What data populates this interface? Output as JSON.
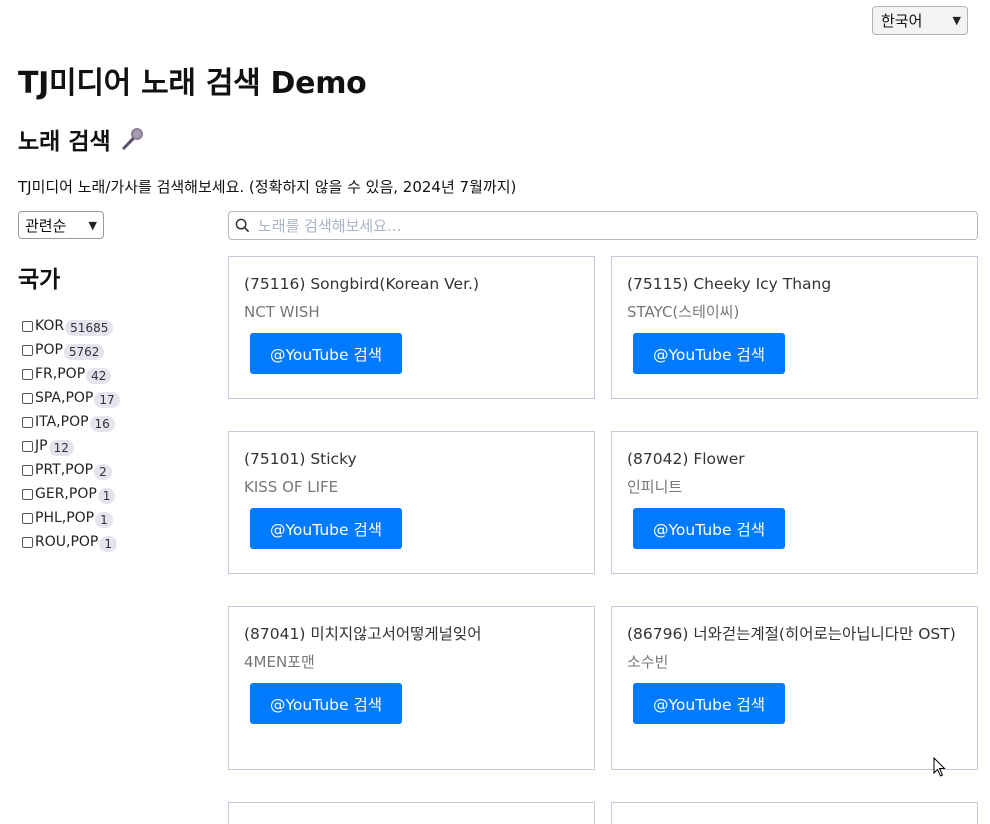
{
  "language_select": {
    "value": "한국어"
  },
  "page_title": "TJ미디어 노래 검색 Demo",
  "section_title": "노래 검색",
  "description": "TJ미디어 노래/가사를 검색해보세요. (정확하지 않을 수 있음, 2024년 7월까지)",
  "sort_select": {
    "value": "관련순"
  },
  "search": {
    "placeholder": "노래를 검색해보세요..."
  },
  "filter": {
    "title": "국가",
    "items": [
      {
        "label": "KOR",
        "count": "51685"
      },
      {
        "label": "POP",
        "count": "5762"
      },
      {
        "label": "FR,POP",
        "count": "42"
      },
      {
        "label": "SPA,POP",
        "count": "17"
      },
      {
        "label": "ITA,POP",
        "count": "16"
      },
      {
        "label": "JP",
        "count": "12"
      },
      {
        "label": "PRT,POP",
        "count": "2"
      },
      {
        "label": "GER,POP",
        "count": "1"
      },
      {
        "label": "PHL,POP",
        "count": "1"
      },
      {
        "label": "ROU,POP",
        "count": "1"
      }
    ]
  },
  "results": [
    {
      "title": "(75116) Songbird(Korean Ver.)",
      "artist": "NCT WISH",
      "button": "@YouTube 검색"
    },
    {
      "title": "(75115) Cheeky Icy Thang",
      "artist": "STAYC(스테이씨)",
      "button": "@YouTube 검색"
    },
    {
      "title": "(75101) Sticky",
      "artist": "KISS OF LIFE",
      "button": "@YouTube 검색"
    },
    {
      "title": "(87042) Flower",
      "artist": "인피니트",
      "button": "@YouTube 검색"
    },
    {
      "title": "(87041) 미치지않고서어떻게널잊어",
      "artist": "4MEN포맨",
      "button": "@YouTube 검색"
    },
    {
      "title": "(86796) 너와걷는계절(히어로는아닙니다만 OST)",
      "artist": "소수빈",
      "button": "@YouTube 검색"
    },
    {
      "title": "",
      "artist": "",
      "button": ""
    },
    {
      "title": "",
      "artist": "",
      "button": ""
    }
  ],
  "colors": {
    "accent": "#007bff",
    "card_border": "#c7c9da",
    "badge_bg": "#e4e4ef"
  }
}
